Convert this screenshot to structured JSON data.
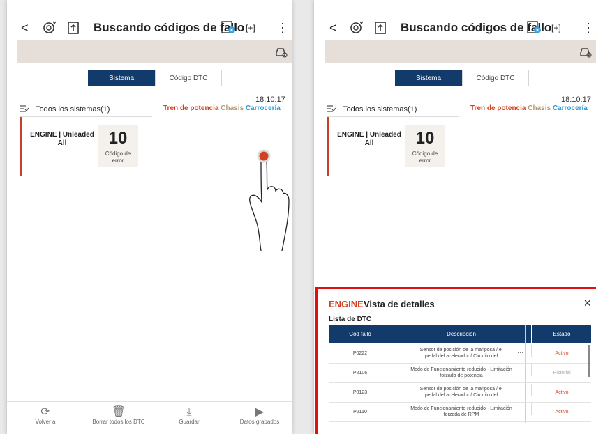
{
  "screen": {
    "back": "<",
    "title": "Buscando códigos de fallo",
    "more": "⋮",
    "focus_icon": "[+]",
    "icons": {
      "scan": "scan-icon",
      "export": "export-icon",
      "clear": "clear-codes-icon",
      "car": "car-icon"
    },
    "tabs": {
      "system": "Sistema",
      "dtc": "Código DTC"
    },
    "time": "18:10:17",
    "systems_label": "Todos los sistemas(1)",
    "categories": {
      "powertrain": "Tren de potencia",
      "chassis": "Chasis",
      "body": "Carrocería"
    },
    "card": {
      "engine_line1": "ENGINE | Unleaded",
      "engine_line2": "All",
      "count": "10",
      "count_label_1": "Código de",
      "count_label_2": "error"
    },
    "bottom": {
      "back": "Volver a",
      "clear_all": "Borrar todos los DTC",
      "save": "Guardar",
      "recorded": "Datos grabados"
    }
  },
  "detail": {
    "engine": "ENGINE",
    "title": "Vista de detalles",
    "close": "×",
    "list_label": "Lista de DTC",
    "headers": {
      "code": "Cod fallo",
      "desc": "Descripción",
      "status": "Estado"
    },
    "rows": [
      {
        "code": "P0222",
        "desc1": "Sensor de posición de la mariposa / el",
        "desc2": "pedal del acelerador / Circuito del",
        "dots": "···",
        "status": "Activo",
        "status_type": "active"
      },
      {
        "code": "P2106",
        "desc1": "Modo de Funcionamiento reducido - Limitación",
        "desc2": "forzada de potencia",
        "dots": "",
        "status": "Historial",
        "status_type": "history"
      },
      {
        "code": "P0123",
        "desc1": "Sensor de posición de la mariposa / el",
        "desc2": "pedal del acelerador / Circuito del",
        "dots": "···",
        "status": "Activo",
        "status_type": "active"
      },
      {
        "code": "P2110",
        "desc1": "Modo de Funcionamiento reducido - Limitación",
        "desc2": "forzada de RPM",
        "dots": "",
        "status": "Activo",
        "status_type": "active"
      }
    ]
  },
  "colors": {
    "navy": "#123a6b",
    "accent_red": "#d2401f",
    "highlight": "#e10f0f",
    "chassis": "#b39d75",
    "body": "#2e9ad6"
  }
}
